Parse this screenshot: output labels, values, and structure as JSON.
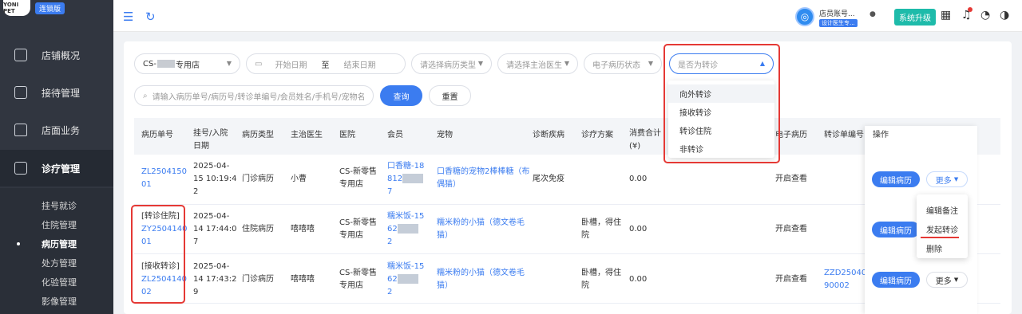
{
  "sidebar": {
    "logo": "YONI PET",
    "badge": "连锁版",
    "menu": [
      {
        "label": "店铺概况"
      },
      {
        "label": "接待管理"
      },
      {
        "label": "店面业务"
      },
      {
        "label": "诊疗管理"
      }
    ],
    "submenu": [
      {
        "label": "挂号就诊"
      },
      {
        "label": "住院管理"
      },
      {
        "label": "病历管理"
      },
      {
        "label": "处方管理"
      },
      {
        "label": "化验管理"
      },
      {
        "label": "影像管理"
      }
    ]
  },
  "topbar": {
    "store_name": "店员账号...",
    "store_tag": "设计医生专...",
    "upgrade": "系统升级"
  },
  "filters": {
    "store": "CS-",
    "store_suffix": "专用店",
    "start_date": "开始日期",
    "to": "至",
    "end_date": "结束日期",
    "record_type": "请选择病历类型",
    "doctor": "请选择主治医生",
    "e_record_status": "电子病历状态",
    "is_transfer": "是否为转诊",
    "search_placeholder": "请输入病历单号/病历号/转诊单编号/会员姓名/手机号/宠物名",
    "query_btn": "查询",
    "reset_btn": "重置"
  },
  "transfer_options": [
    "向外转诊",
    "接收转诊",
    "转诊住院",
    "非转诊"
  ],
  "table": {
    "headers": {
      "record_no": "病历单号",
      "reg_date_1": "挂号/入院",
      "reg_date_2": "日期",
      "type": "病历类型",
      "doctor": "主治医生",
      "hospital": "医院",
      "member": "会员",
      "pet": "宠物",
      "diagnosis": "诊断疾病",
      "plan": "诊疗方案",
      "cost_1": "消费合计",
      "cost_2": "(¥)",
      "e_record": "电子病历",
      "transfer_no": "转诊单编号",
      "ops": "操作"
    },
    "rows": [
      {
        "tag": "",
        "no_1": "ZL2504150",
        "no_2": "01",
        "date_1": "2025-04-",
        "date_2": "15 10:19:4",
        "date_3": "2",
        "type": "门诊病历",
        "doctor": "小曹",
        "hospital_1": "CS-新零售",
        "hospital_2": "专用店",
        "member_1": "口香糖-18",
        "member_2": "812",
        "member_3": "7",
        "pet_1": "口香糖的宠物2棒棒糖（布",
        "pet_2": "偶猫）",
        "diagnosis": "尾次免疫",
        "plan_1": "",
        "plan_2": "",
        "cost": "0.00",
        "e_record": "开启查看",
        "transfer_no_1": "",
        "transfer_no_2": ""
      },
      {
        "tag": "[转诊住院]",
        "no_1": "ZY2504140",
        "no_2": "01",
        "date_1": "2025-04-",
        "date_2": "14 17:44:0",
        "date_3": "7",
        "type": "住院病历",
        "doctor": "嘻嘻嘻",
        "hospital_1": "CS-新零售",
        "hospital_2": "专用店",
        "member_1": "糯米饭-15",
        "member_2": "62",
        "member_3": "2",
        "pet_1": "糯米粉的小猫（德文卷毛",
        "pet_2": "猫）",
        "diagnosis": "",
        "plan_1": "卧槽，得住",
        "plan_2": "院",
        "cost": "0.00",
        "e_record": "开启查看",
        "transfer_no_1": "",
        "transfer_no_2": ""
      },
      {
        "tag": "[接收转诊]",
        "no_1": "ZL2504140",
        "no_2": "02",
        "date_1": "2025-04-",
        "date_2": "14 17:43:2",
        "date_3": "9",
        "type": "门诊病历",
        "doctor": "嘻嘻嘻",
        "hospital_1": "CS-新零售",
        "hospital_2": "专用店",
        "member_1": "糯米饭-15",
        "member_2": "62",
        "member_3": "2",
        "pet_1": "糯米粉的小猫（德文卷毛",
        "pet_2": "猫）",
        "diagnosis": "",
        "plan_1": "卧槽，得住",
        "plan_2": "院",
        "cost": "0.00",
        "e_record": "开启查看",
        "transfer_no_1": "ZZD25040",
        "transfer_no_2": "90002"
      }
    ],
    "edit_btn": "编辑病历",
    "more_btn": "更多"
  },
  "more_menu": [
    "编辑备注",
    "发起转诊",
    "删除"
  ],
  "colors": {
    "accent": "#3b7cf0",
    "sidebar": "#313640",
    "highlight": "#e53935",
    "upgrade": "#1ebbaa"
  }
}
